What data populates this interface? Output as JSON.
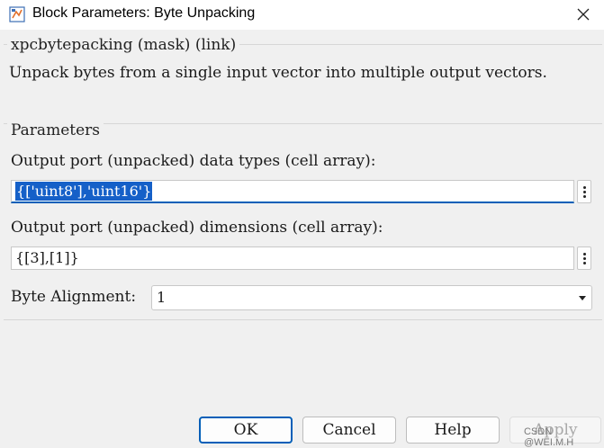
{
  "window": {
    "title": "Block Parameters: Byte Unpacking"
  },
  "mask": {
    "legend": "xpcbytepacking (mask) (link)",
    "description": "Unpack bytes from a single input vector into multiple output vectors."
  },
  "parameters": {
    "legend": "Parameters",
    "data_types_label": "Output port (unpacked) data types (cell array):",
    "data_types_value": "{['uint8'],'uint16'}",
    "dimensions_label": "Output port (unpacked) dimensions (cell array):",
    "dimensions_value": "{[3],[1]}",
    "byte_alignment_label": "Byte Alignment:",
    "byte_alignment_value": "1"
  },
  "buttons": {
    "ok": "OK",
    "cancel": "Cancel",
    "help": "Help",
    "apply": "Apply"
  },
  "watermark": "CSDN @WEI.M.H",
  "colors": {
    "focus": "#005fb8",
    "selection": "#1560c8",
    "background": "#f0f0f0"
  }
}
